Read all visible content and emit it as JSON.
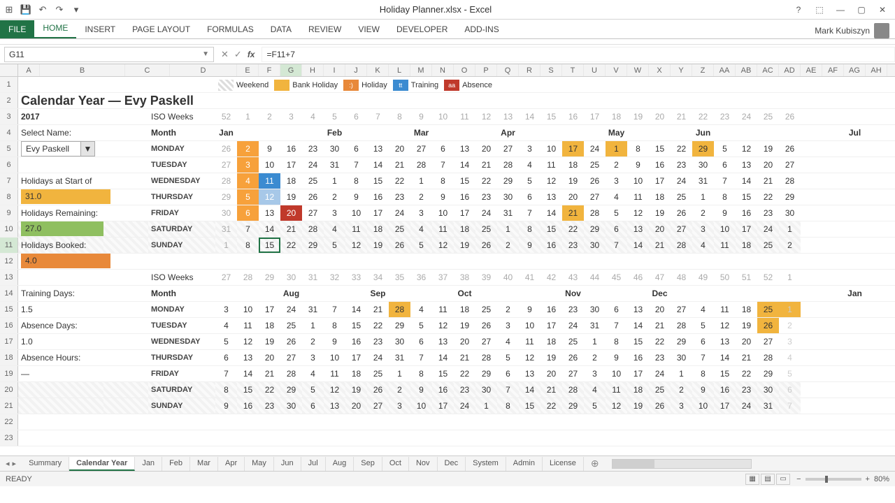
{
  "window": {
    "title": "Holiday Planner.xlsx - Excel",
    "user": "Mark Kubiszyn"
  },
  "ribbon": {
    "tabs": [
      "FILE",
      "HOME",
      "INSERT",
      "PAGE LAYOUT",
      "FORMULAS",
      "DATA",
      "REVIEW",
      "VIEW",
      "DEVELOPER",
      "ADD-INS"
    ]
  },
  "namebox": "G11",
  "formula": "=F11+7",
  "header": {
    "title": "Calendar Year — Evy Paskell",
    "year": "2017",
    "iso_label": "ISO Weeks",
    "month_label": "Month",
    "select_name_label": "Select Name:",
    "selected_name": "Evy Paskell"
  },
  "summary": {
    "start_label": "Holidays at Start of Year:",
    "start_val": "31.0",
    "remain_label": "Holidays Remaining:",
    "remain_val": "27.0",
    "booked_label": "Holidays Booked:",
    "booked_val": "4.0",
    "train_label": "Training Days:",
    "train_val": "1.5",
    "absence_days_label": "Absence Days:",
    "absence_days_val": "1.0",
    "absence_hours_label": "Absence Hours:",
    "absence_hours_val": "—"
  },
  "legend": {
    "weekend": "Weekend",
    "bank": "Bank Holiday",
    "holiday": "Holiday",
    "training": "Training",
    "absence": "Absence",
    "bank_sw": "×ק",
    "hol_sw": ":)",
    "train_sw": "tt",
    "abs_sw": "aa"
  },
  "cols": [
    "A",
    "B",
    "C",
    "D",
    "E",
    "F",
    "G",
    "H",
    "I",
    "J",
    "K",
    "L",
    "M",
    "N",
    "O",
    "P",
    "Q",
    "R",
    "S",
    "T",
    "U",
    "V",
    "W",
    "X",
    "Y",
    "Z",
    "AA",
    "AB",
    "AC",
    "AD",
    "AE",
    "AF",
    "AG",
    "AH"
  ],
  "days": [
    "MONDAY",
    "TUESDAY",
    "WEDNESDAY",
    "THURSDAY",
    "FRIDAY",
    "SATURDAY",
    "SUNDAY"
  ],
  "top": {
    "iso": [
      "52",
      "1",
      "2",
      "3",
      "4",
      "5",
      "6",
      "7",
      "8",
      "9",
      "10",
      "11",
      "12",
      "13",
      "14",
      "15",
      "16",
      "17",
      "18",
      "19",
      "20",
      "21",
      "22",
      "23",
      "24",
      "25",
      "26"
    ],
    "months": {
      "E": "Jan",
      "J": "Feb",
      "N": "Mar",
      "R": "Apr",
      "W": "May",
      "AA": "Jun",
      "AH": "Jul"
    },
    "grid": {
      "MONDAY": [
        "26",
        "2",
        "9",
        "16",
        "23",
        "30",
        "6",
        "13",
        "20",
        "27",
        "6",
        "13",
        "20",
        "27",
        "3",
        "10",
        "17",
        "24",
        "1",
        "8",
        "15",
        "22",
        "29",
        "5",
        "12",
        "19",
        "26"
      ],
      "TUESDAY": [
        "27",
        "3",
        "10",
        "17",
        "24",
        "31",
        "7",
        "14",
        "21",
        "28",
        "7",
        "14",
        "21",
        "28",
        "4",
        "11",
        "18",
        "25",
        "2",
        "9",
        "16",
        "23",
        "30",
        "6",
        "13",
        "20",
        "27"
      ],
      "WEDNESDAY": [
        "28",
        "4",
        "11",
        "18",
        "25",
        "1",
        "8",
        "15",
        "22",
        "1",
        "8",
        "15",
        "22",
        "29",
        "5",
        "12",
        "19",
        "26",
        "3",
        "10",
        "17",
        "24",
        "31",
        "7",
        "14",
        "21",
        "28"
      ],
      "THURSDAY": [
        "29",
        "5",
        "12",
        "19",
        "26",
        "2",
        "9",
        "16",
        "23",
        "2",
        "9",
        "16",
        "23",
        "30",
        "6",
        "13",
        "20",
        "27",
        "4",
        "11",
        "18",
        "25",
        "1",
        "8",
        "15",
        "22",
        "29"
      ],
      "FRIDAY": [
        "30",
        "6",
        "13",
        "20",
        "27",
        "3",
        "10",
        "17",
        "24",
        "3",
        "10",
        "17",
        "24",
        "31",
        "7",
        "14",
        "21",
        "28",
        "5",
        "12",
        "19",
        "26",
        "2",
        "9",
        "16",
        "23",
        "30"
      ],
      "SATURDAY": [
        "31",
        "7",
        "14",
        "21",
        "28",
        "4",
        "11",
        "18",
        "25",
        "4",
        "11",
        "18",
        "25",
        "1",
        "8",
        "15",
        "22",
        "29",
        "6",
        "13",
        "20",
        "27",
        "3",
        "10",
        "17",
        "24",
        "1"
      ],
      "SUNDAY": [
        "1",
        "8",
        "15",
        "22",
        "29",
        "5",
        "12",
        "19",
        "26",
        "5",
        "12",
        "19",
        "26",
        "2",
        "9",
        "16",
        "23",
        "30",
        "7",
        "14",
        "21",
        "28",
        "4",
        "11",
        "18",
        "25",
        "2"
      ]
    },
    "hl": {
      "MONDAY": {
        "1": "hl-jan",
        "16": "hl-amber",
        "18": "hl-amber",
        "22": "hl-amber"
      },
      "TUESDAY": {
        "1": "hl-jan"
      },
      "WEDNESDAY": {
        "1": "hl-jan",
        "2": "hl-blue"
      },
      "THURSDAY": {
        "1": "hl-jan",
        "2": "hl-blue-lt"
      },
      "FRIDAY": {
        "1": "hl-jan",
        "3": "hl-red",
        "16": "hl-amber"
      },
      "SATURDAY": {},
      "SUNDAY": {}
    }
  },
  "bottom": {
    "iso": [
      "27",
      "28",
      "29",
      "30",
      "31",
      "32",
      "33",
      "34",
      "35",
      "36",
      "37",
      "38",
      "39",
      "40",
      "41",
      "42",
      "43",
      "44",
      "45",
      "46",
      "47",
      "48",
      "49",
      "50",
      "51",
      "52",
      "1"
    ],
    "months": {
      "H": "Aug",
      "L": "Sep",
      "P": "Oct",
      "U": "Nov",
      "Y": "Dec",
      "AH": "Jan"
    },
    "grid": {
      "MONDAY": [
        "3",
        "10",
        "17",
        "24",
        "31",
        "7",
        "14",
        "21",
        "28",
        "4",
        "11",
        "18",
        "25",
        "2",
        "9",
        "16",
        "23",
        "30",
        "6",
        "13",
        "20",
        "27",
        "4",
        "11",
        "18",
        "25",
        "1"
      ],
      "TUESDAY": [
        "4",
        "11",
        "18",
        "25",
        "1",
        "8",
        "15",
        "22",
        "29",
        "5",
        "12",
        "19",
        "26",
        "3",
        "10",
        "17",
        "24",
        "31",
        "7",
        "14",
        "21",
        "28",
        "5",
        "12",
        "19",
        "26",
        "2"
      ],
      "WEDNESDAY": [
        "5",
        "12",
        "19",
        "26",
        "2",
        "9",
        "16",
        "23",
        "30",
        "6",
        "13",
        "20",
        "27",
        "4",
        "11",
        "18",
        "25",
        "1",
        "8",
        "15",
        "22",
        "29",
        "6",
        "13",
        "20",
        "27",
        "3"
      ],
      "THURSDAY": [
        "6",
        "13",
        "20",
        "27",
        "3",
        "10",
        "17",
        "24",
        "31",
        "7",
        "14",
        "21",
        "28",
        "5",
        "12",
        "19",
        "26",
        "2",
        "9",
        "16",
        "23",
        "30",
        "7",
        "14",
        "21",
        "28",
        "4"
      ],
      "FRIDAY": [
        "7",
        "14",
        "21",
        "28",
        "4",
        "11",
        "18",
        "25",
        "1",
        "8",
        "15",
        "22",
        "29",
        "6",
        "13",
        "20",
        "27",
        "3",
        "10",
        "17",
        "24",
        "1",
        "8",
        "15",
        "22",
        "29",
        "5"
      ],
      "SATURDAY": [
        "8",
        "15",
        "22",
        "29",
        "5",
        "12",
        "19",
        "26",
        "2",
        "9",
        "16",
        "23",
        "30",
        "7",
        "14",
        "21",
        "28",
        "4",
        "11",
        "18",
        "25",
        "2",
        "9",
        "16",
        "23",
        "30",
        "6"
      ],
      "SUNDAY": [
        "9",
        "16",
        "23",
        "30",
        "6",
        "13",
        "20",
        "27",
        "3",
        "10",
        "17",
        "24",
        "1",
        "8",
        "15",
        "22",
        "29",
        "5",
        "12",
        "19",
        "26",
        "3",
        "10",
        "17",
        "24",
        "31",
        "7"
      ]
    },
    "hl": {
      "MONDAY": {
        "8": "hl-amber",
        "25": "hl-amber",
        "26": "hl-amber"
      },
      "TUESDAY": {
        "25": "hl-amber"
      },
      "WEDNESDAY": {},
      "THURSDAY": {},
      "FRIDAY": {},
      "SATURDAY": {},
      "SUNDAY": {}
    }
  },
  "sheets": [
    "Summary",
    "Calendar Year",
    "Jan",
    "Feb",
    "Mar",
    "Apr",
    "May",
    "Jun",
    "Jul",
    "Aug",
    "Sep",
    "Oct",
    "Nov",
    "Dec",
    "System",
    "Admin",
    "License"
  ],
  "active_sheet": "Calendar Year",
  "status": {
    "ready": "READY",
    "zoom": "80%"
  }
}
